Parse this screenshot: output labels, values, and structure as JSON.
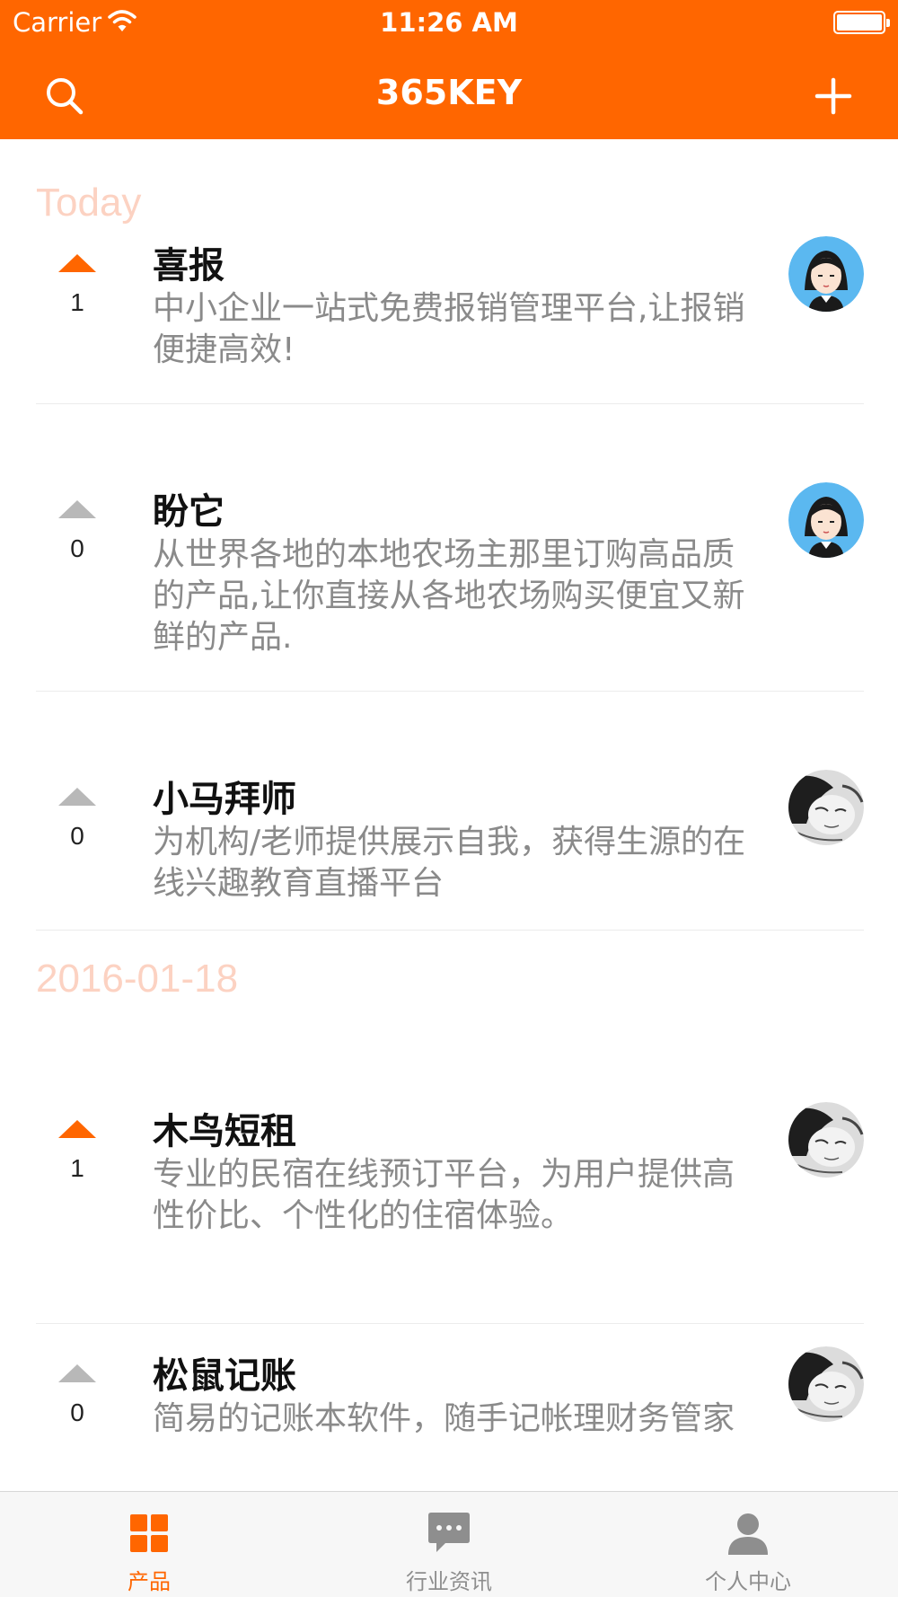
{
  "status_bar": {
    "carrier": "Carrier",
    "time": "11:26 AM"
  },
  "navbar": {
    "title": "365KEY",
    "left_icon": "search-icon",
    "right_icon": "plus-icon"
  },
  "colors": {
    "brand": "#ff6600",
    "section_title": "#fcd2c2",
    "desc_text": "#8a8a8a",
    "arrow_inactive": "#b8b8b8"
  },
  "sections": [
    {
      "title": "Today",
      "items": [
        {
          "title": "喜报",
          "desc": "中小企业一站式免费报销管理平台,让报销便捷高效!",
          "votes": "1",
          "voted": true,
          "avatar": "cartoon-girl-avatar"
        },
        {
          "title": "盼它",
          "desc": "从世界各地的本地农场主那里订购高品质的产品,让你直接从各地农场购买便宜又新鲜的产品.",
          "votes": "0",
          "voted": false,
          "avatar": "cartoon-girl-avatar"
        },
        {
          "title": "小马拜师",
          "desc": "为机构/老师提供展示自我，获得生源的在线兴趣教育直播平台",
          "votes": "0",
          "voted": false,
          "avatar": "sketch-face-avatar"
        }
      ]
    },
    {
      "title": "2016-01-18",
      "items": [
        {
          "title": "木鸟短租",
          "desc": "专业的民宿在线预订平台，为用户提供高性价比、个性化的住宿体验。",
          "votes": "1",
          "voted": true,
          "avatar": "sketch-face-avatar"
        },
        {
          "title": "松鼠记账",
          "desc": "简易的记账本软件，随手记帐理财务管家",
          "votes": "0",
          "voted": false,
          "avatar": "sketch-face-avatar"
        }
      ]
    }
  ],
  "tabbar": [
    {
      "label": "产品",
      "icon": "grid-icon",
      "active": true
    },
    {
      "label": "行业资讯",
      "icon": "chat-bubble-icon",
      "active": false
    },
    {
      "label": "个人中心",
      "icon": "person-icon",
      "active": false
    }
  ]
}
